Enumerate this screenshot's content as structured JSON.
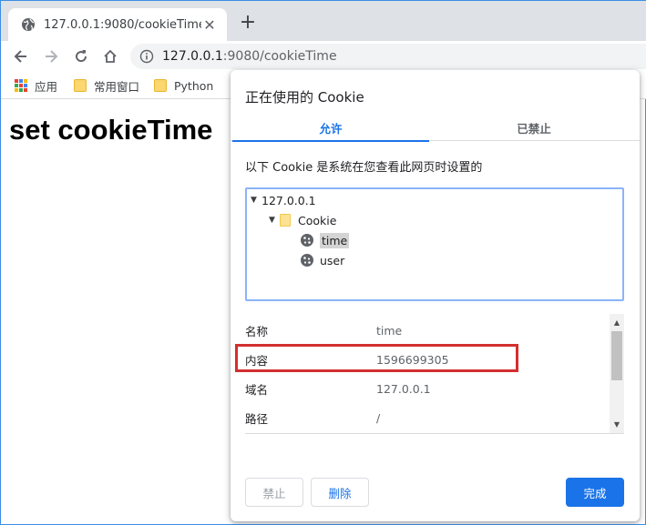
{
  "browser": {
    "tab": {
      "title": "127.0.0.1:9080/cookieTime",
      "close_glyph": "✕",
      "icon": "globe-icon"
    },
    "new_tab_glyph": "+",
    "address": {
      "host": "127.0.0.1",
      "port_path": ":9080/cookieTime",
      "icon": "info-icon"
    },
    "bookmarks": [
      {
        "label": "应用",
        "icon": "apps-grid-icon"
      },
      {
        "label": "常用窗口",
        "icon": "folder-icon"
      },
      {
        "label": "Python",
        "icon": "folder-icon"
      }
    ]
  },
  "page": {
    "heading": "set cookieTime"
  },
  "dialog": {
    "title": "正在使用的 Cookie",
    "tabs": {
      "allowed": "允许",
      "blocked": "已禁止"
    },
    "description": "以下 Cookie 是系统在您查看此网页时设置的",
    "tree": {
      "site": "127.0.0.1",
      "folder": "Cookie",
      "cookies": [
        "time",
        "user"
      ],
      "selected": "time"
    },
    "properties": [
      {
        "key": "名称",
        "value": "time"
      },
      {
        "key": "内容",
        "value": "1596699305"
      },
      {
        "key": "域名",
        "value": "127.0.0.1"
      },
      {
        "key": "路径",
        "value": "/"
      }
    ],
    "buttons": {
      "block": "禁止",
      "delete": "删除",
      "done": "完成"
    }
  },
  "colors": {
    "accent": "#1a73e8",
    "highlight": "#d32f2f",
    "tabstrip": "#dee1e6",
    "omnibox": "#f1f3f4"
  }
}
